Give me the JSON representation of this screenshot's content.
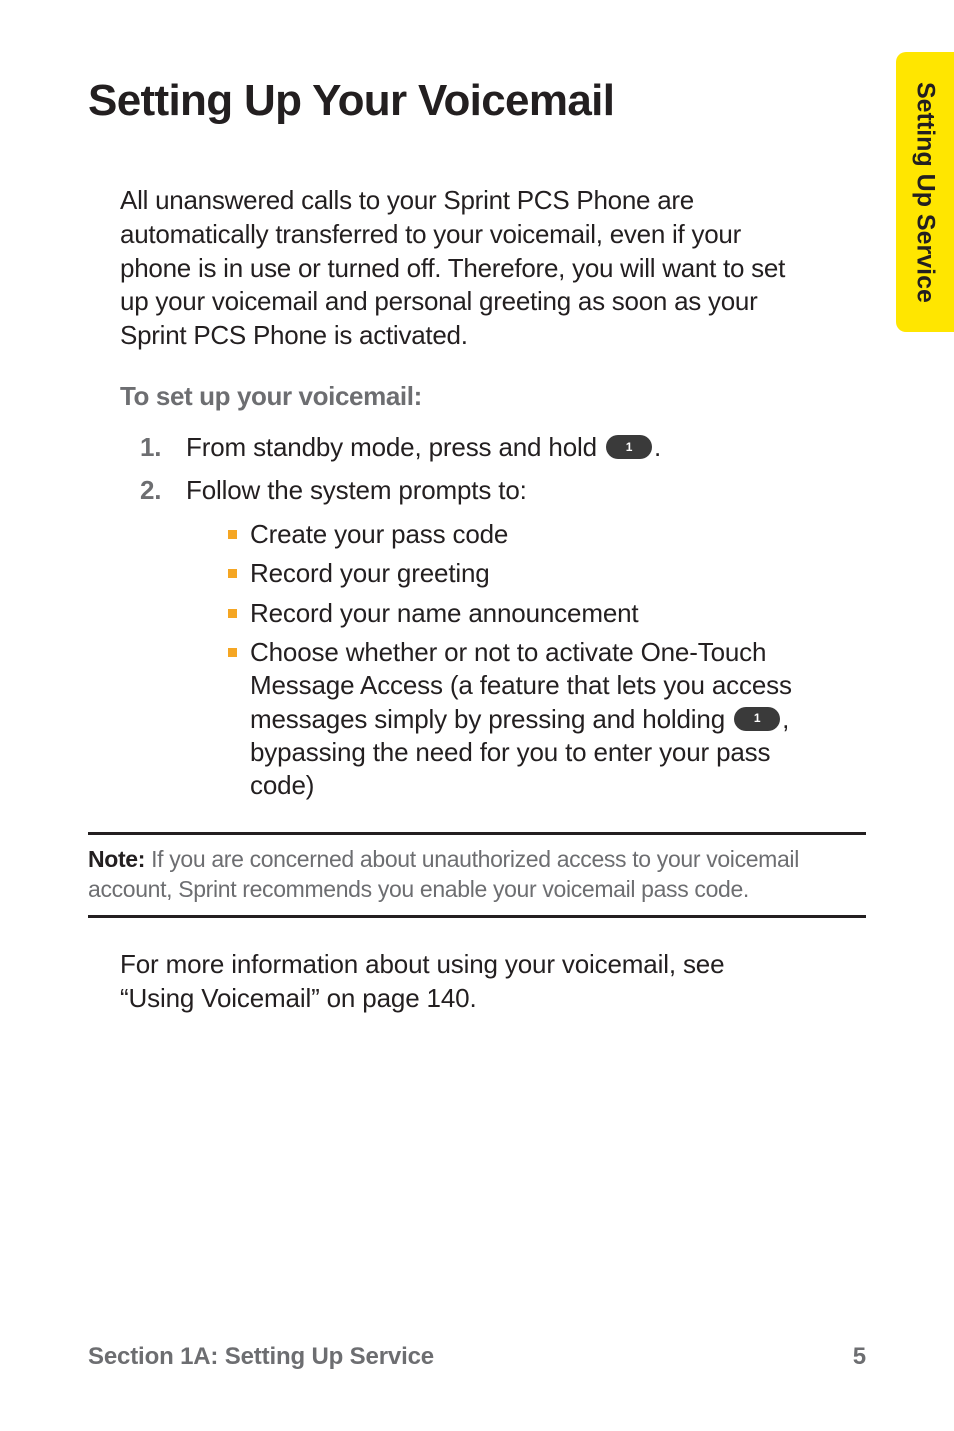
{
  "tab": {
    "label": "Setting Up Service"
  },
  "title": "Setting Up Your Voicemail",
  "intro": "All unanswered calls to your Sprint PCS Phone are automatically transferred to your voicemail, even if your phone is in use or turned off. Therefore, you will want to set up your voicemail and personal greeting as soon as your Sprint PCS Phone is activated.",
  "subhead": "To set up your voicemail:",
  "steps": [
    {
      "num": "1.",
      "body_pre": "From standby mode, press and hold ",
      "key": "1",
      "body_post": "."
    },
    {
      "num": "2.",
      "body": "Follow the system prompts to:",
      "bullets": [
        {
          "text": "Create your pass code"
        },
        {
          "text": "Record your greeting"
        },
        {
          "text": "Record your name announcement"
        },
        {
          "pre": "Choose whether or not to activate One-Touch Message Access (a feature that lets you access messages simply by pressing and holding ",
          "key": "1",
          "post": ", bypassing the need for you to enter your pass code)"
        }
      ]
    }
  ],
  "note": {
    "label": "Note:",
    "text": " If you are concerned about unauthorized access to your voicemail account, Sprint recommends you enable your voicemail pass code."
  },
  "closing": "For more information about using your voicemail, see “Using Voicemail” on page 140.",
  "footer": {
    "left": "Section 1A: Setting Up Service",
    "right": "5"
  }
}
